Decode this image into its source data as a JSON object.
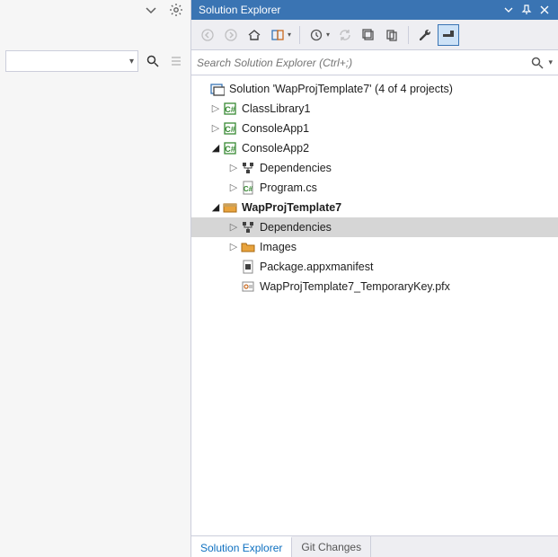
{
  "left": {
    "dropdown_value": ""
  },
  "panel": {
    "title": "Solution Explorer",
    "search_placeholder": "Search Solution Explorer (Ctrl+;)"
  },
  "solution": {
    "label": "Solution 'WapProjTemplate7' (4 of 4 projects)"
  },
  "nodes": {
    "classlib": "ClassLibrary1",
    "console1": "ConsoleApp1",
    "console2": "ConsoleApp2",
    "c2_dep": "Dependencies",
    "c2_prog": "Program.cs",
    "wap": "WapProjTemplate7",
    "wap_dep": "Dependencies",
    "wap_images": "Images",
    "wap_manifest": "Package.appxmanifest",
    "wap_key": "WapProjTemplate7_TemporaryKey.pfx"
  },
  "tabs": {
    "sol": "Solution Explorer",
    "git": "Git Changes"
  }
}
